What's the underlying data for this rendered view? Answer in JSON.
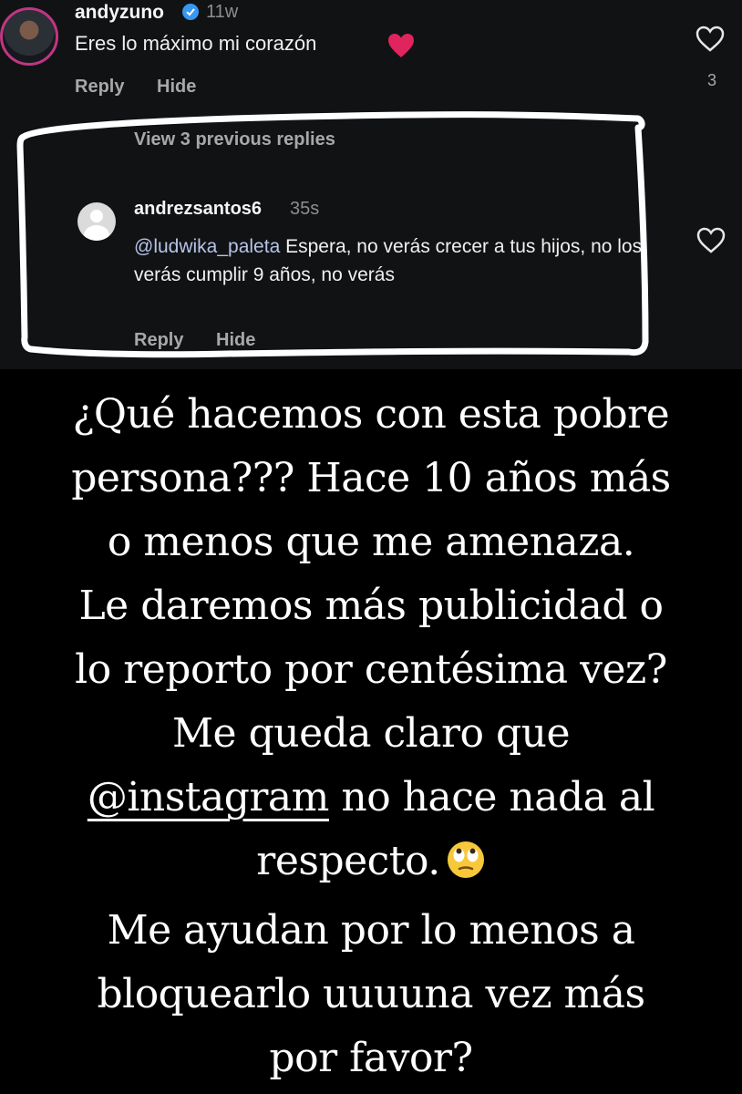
{
  "comment": {
    "username": "andyzuno",
    "time": "11w",
    "text": "Eres lo máximo mi corazón",
    "reply_label": "Reply",
    "hide_label": "Hide",
    "like_count": "3"
  },
  "thread": {
    "view_previous": "View 3 previous replies"
  },
  "reply": {
    "username": "andrezsantos6",
    "time": "35s",
    "mention": "@ludwika_paleta",
    "text": " Espera, no verás crecer a tus hijos, no los verás cumplir 9 años, no verás",
    "reply_label": "Reply",
    "hide_label": "Hide"
  },
  "caption": {
    "line1": "¿Qué hacemos con esta pobre",
    "line2": "persona??? Hace 10 años más",
    "line3": "o menos que me amenaza.",
    "line4": "Le daremos más publicidad o",
    "line5": "lo reporto por centésima vez?",
    "line6": "Me queda claro que",
    "line7_mention": "@instagram",
    "line7_rest": " no hace nada al",
    "line8": "respecto.",
    "line9": "Me ayudan por lo menos a",
    "line10": "bloquearlo uuuuna vez más",
    "line11": "por favor?"
  },
  "icons": {
    "verified": "verified-badge-icon",
    "heart_emoji": "red-heart-emoji",
    "like": "heart-outline-icon",
    "eye_roll": "eye-roll-emoji"
  },
  "colors": {
    "background": "#000000",
    "comments_bg": "#111214",
    "verified": "#3897f0",
    "mention": "#b6c4e8",
    "heart": "#e0245e"
  }
}
